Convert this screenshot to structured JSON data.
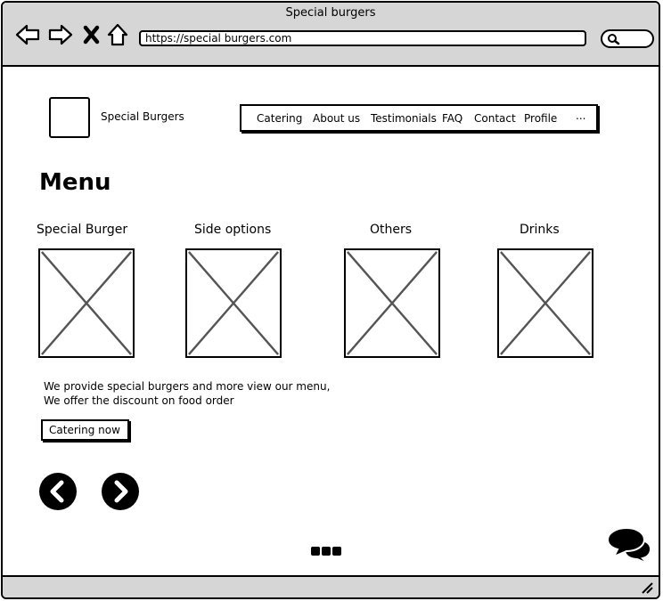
{
  "window": {
    "title": "Special burgers"
  },
  "browser": {
    "url": "https://special burgers.com",
    "icons": [
      "back-arrow-icon",
      "forward-arrow-icon",
      "close-x-icon",
      "home-icon",
      "search-icon"
    ]
  },
  "header": {
    "brand": "Special Burgers",
    "nav": {
      "catering": "Catering",
      "about": "About us",
      "testimonials": "Testimonials",
      "faq": "FAQ",
      "contact": "Contact",
      "profile": "Profile",
      "more": "..."
    }
  },
  "main": {
    "title": "Menu",
    "categories": [
      {
        "label": "Special Burger"
      },
      {
        "label": "Side options"
      },
      {
        "label": "Others"
      },
      {
        "label": "Drinks"
      }
    ],
    "description": {
      "line1": "We provide special burgers and more view our menu,",
      "line2": "We offer the discount on food order"
    },
    "cta_label": "Catering now"
  },
  "colors": {
    "chrome": "#d6d6d6",
    "ink": "#000000",
    "placeholder_x": "#555555"
  }
}
